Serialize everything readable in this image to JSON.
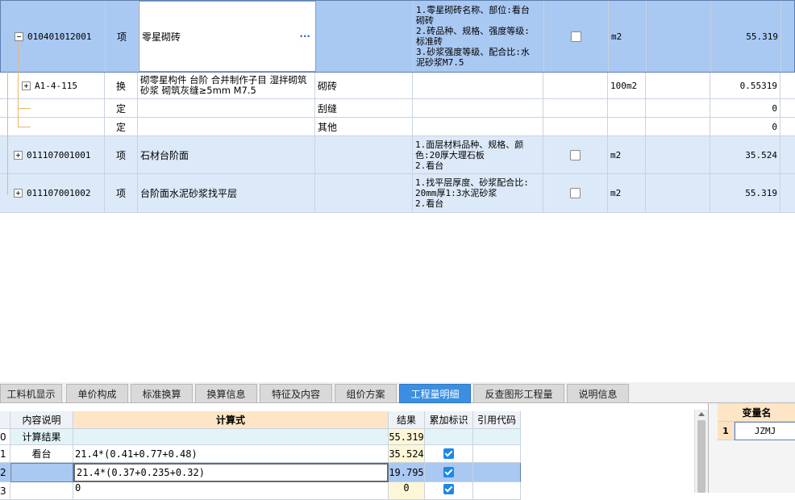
{
  "upper_grid": {
    "rows": [
      {
        "code": "010401012001",
        "type": "项",
        "name": "零星砌砖",
        "content": "",
        "features": "1.零星砌砖名称、部位:看台\n砌砖\n2.砖品种、规格、强度等级:\n标准砖\n3.砂浆强度等级、配合比:水\n泥砂浆M7.5",
        "unit": "m2",
        "quantity": "55.319",
        "more": "···"
      },
      {
        "code": "A1-4-115",
        "type": "换",
        "name": "砌零星构件 台阶  合并制作子目 湿拌砌筑砂浆 砌筑灰缝≥5mm M7.5",
        "content": "砌砖",
        "features": "",
        "unit": "100m2",
        "quantity": "0.55319"
      },
      {
        "code": "",
        "type": "定",
        "name": "",
        "content": "刮缝",
        "features": "",
        "unit": "",
        "quantity": "0"
      },
      {
        "code": "",
        "type": "定",
        "name": "",
        "content": "其他",
        "features": "",
        "unit": "",
        "quantity": "0"
      },
      {
        "code": "011107001001",
        "type": "项",
        "name": "石材台阶面",
        "content": "",
        "features": "1.面层材料品种、规格、颜\n色:20厚大理石板\n2.看台",
        "unit": "m2",
        "quantity": "35.524"
      },
      {
        "code": "011107001002",
        "type": "项",
        "name": "台阶面水泥砂浆找平层",
        "content": "",
        "features": "1.找平层厚度、砂浆配合比:\n20mm厚1:3水泥砂浆\n2.看台",
        "unit": "m2",
        "quantity": "55.319"
      }
    ]
  },
  "tabs": [
    "工料机显示",
    "单价构成",
    "标准换算",
    "换算信息",
    "特征及内容",
    "组价方案",
    "工程量明细",
    "反查图形工程量",
    "说明信息"
  ],
  "active_tab": "工程量明细",
  "detail_grid": {
    "headers": {
      "desc": "内容说明",
      "formula": "计算式",
      "result": "结果",
      "accum": "累加标识",
      "ref": "引用代码"
    },
    "rows": [
      {
        "idx": "0",
        "desc": "计算结果",
        "formula": "",
        "result": "55.319",
        "checked": false
      },
      {
        "idx": "1",
        "desc": "看台",
        "formula": "21.4*(0.41+0.77+0.48)",
        "result": "35.524",
        "checked": true
      },
      {
        "idx": "2",
        "desc": "",
        "formula": "21.4*(0.37+0.235+0.32)",
        "result": "19.795",
        "checked": true
      },
      {
        "idx": "3",
        "desc": "",
        "formula": "0",
        "result": "0",
        "checked": true
      }
    ]
  },
  "variable_panel": {
    "header": "变量名",
    "rows": [
      {
        "idx": "1",
        "name": "JZMJ"
      }
    ]
  },
  "colors": {
    "selected_row": "#a9c8f2",
    "item_row": "#dce9f8",
    "active_tab": "#3c8fe0",
    "header_bg": "#fde5c6"
  }
}
